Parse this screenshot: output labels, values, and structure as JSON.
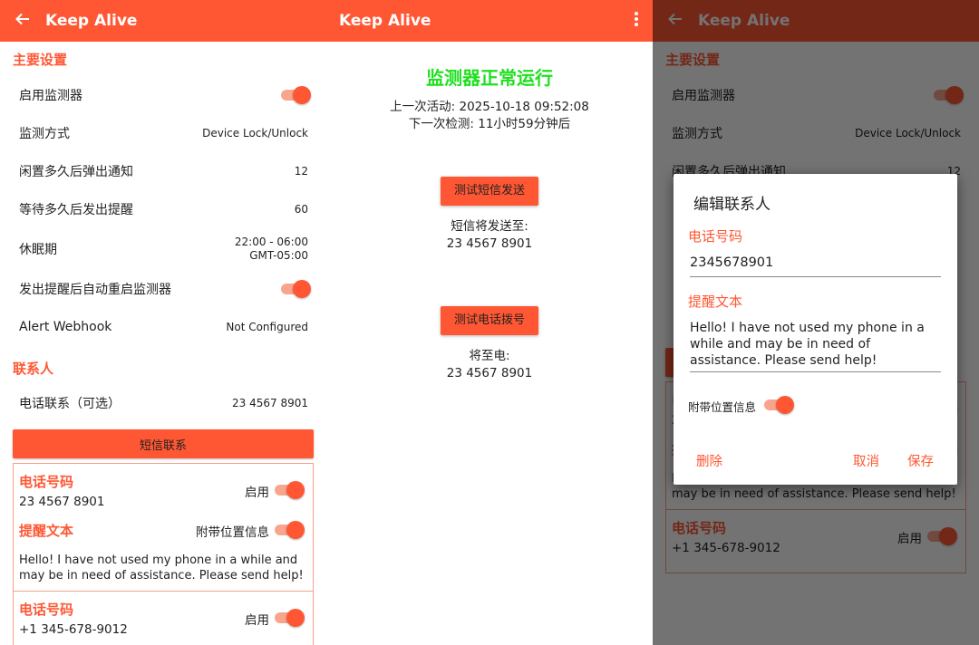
{
  "app_title": "Keep Alive",
  "settings": {
    "main_header": "主要设置",
    "rows": [
      {
        "label": "启用监测器",
        "toggle": true
      },
      {
        "label": "监测方式",
        "value": "Device Lock/Unlock"
      },
      {
        "label": "闲置多久后弹出通知",
        "value": "12"
      },
      {
        "label": "等待多久后发出提醒",
        "value": "60"
      },
      {
        "label": "休眠期",
        "value": "22:00 - 06:00",
        "value2": "GMT-05:00"
      },
      {
        "label": "发出提醒后自动重启监测器",
        "toggle": true
      },
      {
        "label": "Alert Webhook",
        "value": "Not Configured"
      }
    ],
    "contacts_header": "联系人",
    "call_row": {
      "label": "电话联系（可选）",
      "value": "23 4567 8901"
    },
    "sms_button": "短信联系",
    "contacts": [
      {
        "phone_label": "电话号码",
        "phone": "23 4567 8901",
        "enable_label": "启用",
        "message_label": "提醒文本",
        "location_label": "附带位置信息",
        "message": "Hello! I have not used my phone in a while and may be in need of assistance. Please send help!"
      },
      {
        "phone_label": "电话号码",
        "phone": "+1 345-678-9012",
        "enable_label": "启用"
      }
    ]
  },
  "status": {
    "running": "监测器正常运行",
    "last_activity": "上一次活动: 2025-10-18 09:52:08",
    "next_check": "下一次检测: 11小时59分钟后",
    "test_sms_button": "测试短信发送",
    "sms_to_label": "短信将发送至:",
    "sms_to": "23 4567 8901",
    "test_call_button": "测试电话拨号",
    "call_to_label": "将至电:",
    "call_to": "23 4567 8901"
  },
  "dialog": {
    "title": "编辑联系人",
    "phone_label": "电话号码",
    "phone_value": "2345678901",
    "message_label": "提醒文本",
    "message_value": "Hello! I have not used my phone in a while and may be in need of assistance. Please send help!",
    "location_label": "附带位置信息",
    "location_toggle": true,
    "delete": "删除",
    "cancel": "取消",
    "save": "保存"
  },
  "colors": {
    "accent": "#ff5733",
    "status_ok": "#1fe01f",
    "switch_track": "#f9a48e"
  },
  "icons": {
    "back": "arrow-left-icon",
    "menu": "more-vert-icon"
  }
}
